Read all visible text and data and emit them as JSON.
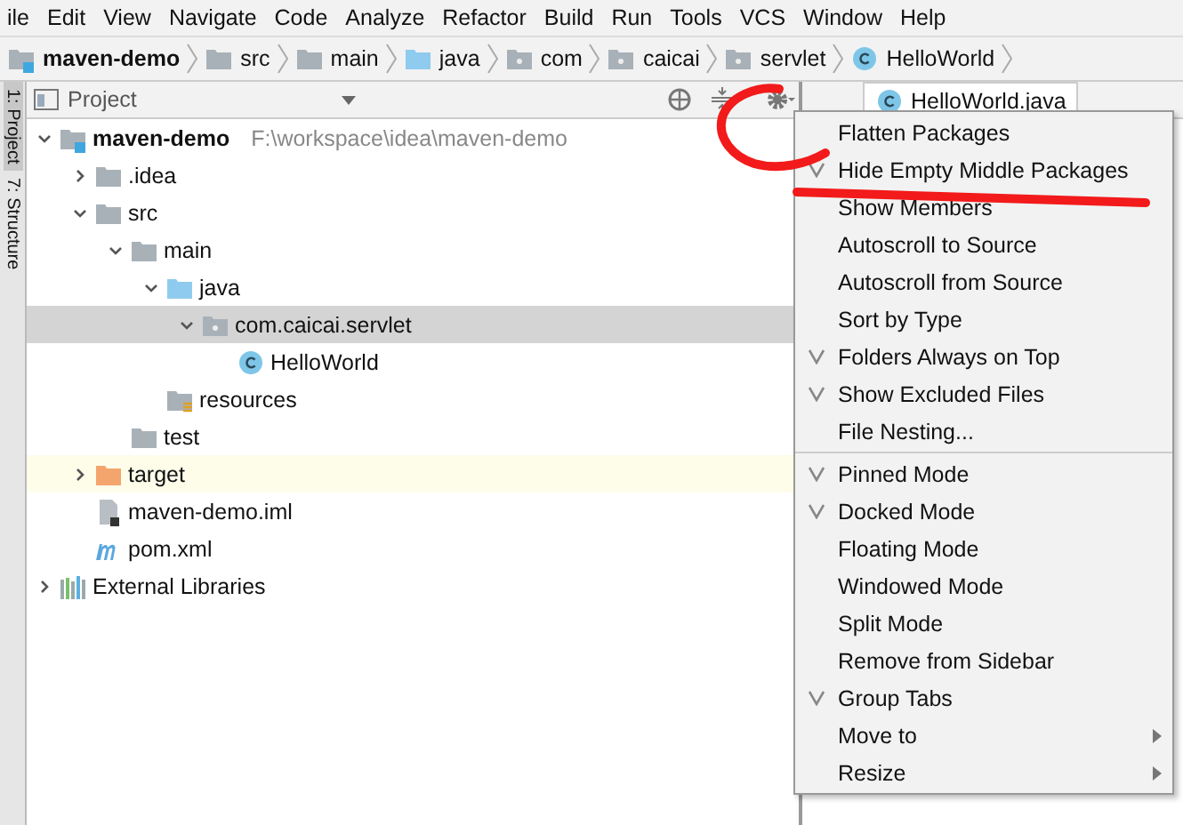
{
  "menu_bar": [
    "ile",
    "Edit",
    "View",
    "Navigate",
    "Code",
    "Analyze",
    "Refactor",
    "Build",
    "Run",
    "Tools",
    "VCS",
    "Window",
    "Help"
  ],
  "breadcrumbs": [
    {
      "label": "maven-demo",
      "kind": "module"
    },
    {
      "label": "src",
      "kind": "folder"
    },
    {
      "label": "main",
      "kind": "folder"
    },
    {
      "label": "java",
      "kind": "source"
    },
    {
      "label": "com",
      "kind": "package"
    },
    {
      "label": "caicai",
      "kind": "package"
    },
    {
      "label": "servlet",
      "kind": "package"
    },
    {
      "label": "HelloWorld",
      "kind": "class"
    }
  ],
  "side_tabs": [
    "1: Project",
    "7: Structure"
  ],
  "project_panel": {
    "title": "Project"
  },
  "editor_tab": {
    "label": "HelloWorld.java"
  },
  "tree": [
    {
      "label": "maven-demo",
      "path": "F:\\workspace\\idea\\maven-demo",
      "kind": "module",
      "expanded": true,
      "selected": false,
      "excluded": false,
      "children": [
        {
          "label": ".idea",
          "kind": "folder",
          "expanded": false,
          "selected": false,
          "excluded": false
        },
        {
          "label": "src",
          "kind": "folder",
          "expanded": true,
          "selected": false,
          "excluded": false,
          "children": [
            {
              "label": "main",
              "kind": "folder",
              "expanded": true,
              "selected": false,
              "excluded": false,
              "children": [
                {
                  "label": "java",
                  "kind": "source",
                  "expanded": true,
                  "selected": false,
                  "excluded": false,
                  "children": [
                    {
                      "label": "com.caicai.servlet",
                      "kind": "package",
                      "expanded": true,
                      "selected": true,
                      "excluded": false,
                      "children": [
                        {
                          "label": "HelloWorld",
                          "kind": "class",
                          "selected": false,
                          "excluded": false
                        }
                      ]
                    }
                  ]
                },
                {
                  "label": "resources",
                  "kind": "resources",
                  "selected": false,
                  "excluded": false
                }
              ]
            },
            {
              "label": "test",
              "kind": "folder",
              "selected": false,
              "excluded": false
            }
          ]
        },
        {
          "label": "target",
          "kind": "excluded",
          "expanded": false,
          "selected": false,
          "excluded": true
        },
        {
          "label": "maven-demo.iml",
          "kind": "iml",
          "selected": false,
          "excluded": false
        },
        {
          "label": "pom.xml",
          "kind": "maven",
          "selected": false,
          "excluded": false
        }
      ]
    },
    {
      "label": "External Libraries",
      "kind": "libraries",
      "expanded": false,
      "selected": false,
      "excluded": false
    }
  ],
  "context_menu": [
    {
      "items": [
        {
          "label": "Flatten Packages",
          "checked": false,
          "submenu": false
        },
        {
          "label": "Hide Empty Middle Packages",
          "checked": true,
          "submenu": false
        },
        {
          "label": "Show Members",
          "checked": false,
          "submenu": false
        },
        {
          "label": "Autoscroll to Source",
          "checked": false,
          "submenu": false
        },
        {
          "label": "Autoscroll from Source",
          "checked": false,
          "submenu": false
        },
        {
          "label": "Sort by Type",
          "checked": false,
          "submenu": false
        },
        {
          "label": "Folders Always on Top",
          "checked": true,
          "submenu": false
        },
        {
          "label": "Show Excluded Files",
          "checked": true,
          "submenu": false
        },
        {
          "label": "File Nesting...",
          "checked": false,
          "submenu": false
        }
      ]
    },
    {
      "items": [
        {
          "label": "Pinned Mode",
          "checked": true,
          "submenu": false
        },
        {
          "label": "Docked Mode",
          "checked": true,
          "submenu": false
        },
        {
          "label": "Floating Mode",
          "checked": false,
          "submenu": false
        },
        {
          "label": "Windowed Mode",
          "checked": false,
          "submenu": false
        },
        {
          "label": "Split Mode",
          "checked": false,
          "submenu": false
        },
        {
          "label": "Remove from Sidebar",
          "checked": false,
          "submenu": false
        },
        {
          "label": "Group Tabs",
          "checked": true,
          "submenu": false
        },
        {
          "label": "Move to",
          "checked": false,
          "submenu": true
        },
        {
          "label": "Resize",
          "checked": false,
          "submenu": true
        }
      ]
    }
  ]
}
